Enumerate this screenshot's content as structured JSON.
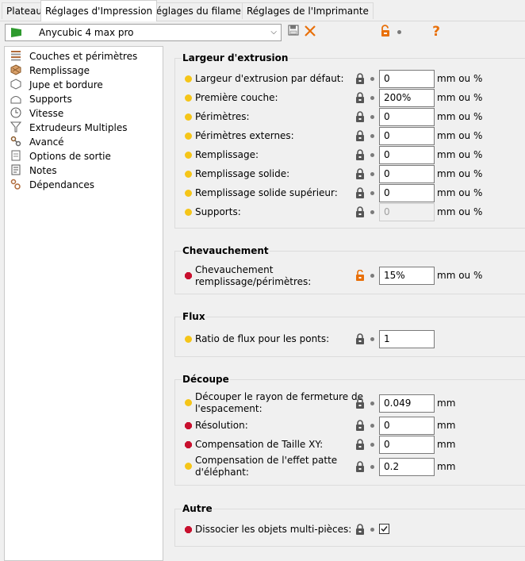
{
  "tabs": [
    "Plateau",
    "Réglages d'Impression",
    "Réglages du filament",
    "Réglages de l'Imprimante"
  ],
  "preset": {
    "name": "Anycubic 4 max pro"
  },
  "colors": {
    "accent_orange": "#e8700a",
    "bullet_yellow": "#f5c518",
    "bullet_red": "#c8102e",
    "flag_green": "#2e9a2e"
  },
  "sidebar": {
    "items": [
      {
        "label": "Couches et périmètres",
        "icon": "layers-icon"
      },
      {
        "label": "Remplissage",
        "icon": "infill-icon"
      },
      {
        "label": "Jupe et bordure",
        "icon": "skirt-icon"
      },
      {
        "label": "Supports",
        "icon": "support-icon"
      },
      {
        "label": "Vitesse",
        "icon": "clock-icon"
      },
      {
        "label": "Extrudeurs Multiples",
        "icon": "funnel-icon"
      },
      {
        "label": "Avancé",
        "icon": "wrench-icon"
      },
      {
        "label": "Options de sortie",
        "icon": "output-icon"
      },
      {
        "label": "Notes",
        "icon": "notes-icon"
      },
      {
        "label": "Dépendances",
        "icon": "dependencies-icon"
      }
    ]
  },
  "groups": {
    "extrusion": {
      "title": "Largeur d'extrusion",
      "rows": [
        {
          "label": "Largeur d'extrusion par défaut:",
          "value": "0",
          "unit": "mm ou %"
        },
        {
          "label": "Première couche:",
          "value": "200%",
          "unit": "mm ou %"
        },
        {
          "label": "Périmètres:",
          "value": "0",
          "unit": "mm ou %"
        },
        {
          "label": "Périmètres externes:",
          "value": "0",
          "unit": "mm ou %"
        },
        {
          "label": "Remplissage:",
          "value": "0",
          "unit": "mm ou %"
        },
        {
          "label": "Remplissage solide:",
          "value": "0",
          "unit": "mm ou %"
        },
        {
          "label": "Remplissage solide supérieur:",
          "value": "0",
          "unit": "mm ou %"
        },
        {
          "label": "Supports:",
          "value": "0",
          "unit": "mm ou %"
        }
      ]
    },
    "overlap": {
      "title": "Chevauchement",
      "rows": [
        {
          "label_line1": "Chevauchement",
          "label_line2": "remplissage/périmètres:",
          "value": "15%",
          "unit": "mm ou %"
        }
      ]
    },
    "flow": {
      "title": "Flux",
      "rows": [
        {
          "label": "Ratio de flux pour les ponts:",
          "value": "1"
        }
      ]
    },
    "slicing": {
      "title": "Découpe",
      "rows": [
        {
          "label_line1": "Découper le rayon de fermeture de",
          "label_line2": "l'espacement:",
          "value": "0.049",
          "unit": "mm"
        },
        {
          "label": "Résolution:",
          "value": "0",
          "unit": "mm"
        },
        {
          "label": "Compensation de Taille XY:",
          "value": "0",
          "unit": "mm"
        },
        {
          "label_line1": "Compensation de l'effet patte",
          "label_line2": "d'éléphant:",
          "value": "0.2",
          "unit": "mm"
        }
      ]
    },
    "other": {
      "title": "Autre",
      "rows": [
        {
          "label": "Dissocier les objets multi-pièces:",
          "checked": true
        }
      ]
    }
  }
}
